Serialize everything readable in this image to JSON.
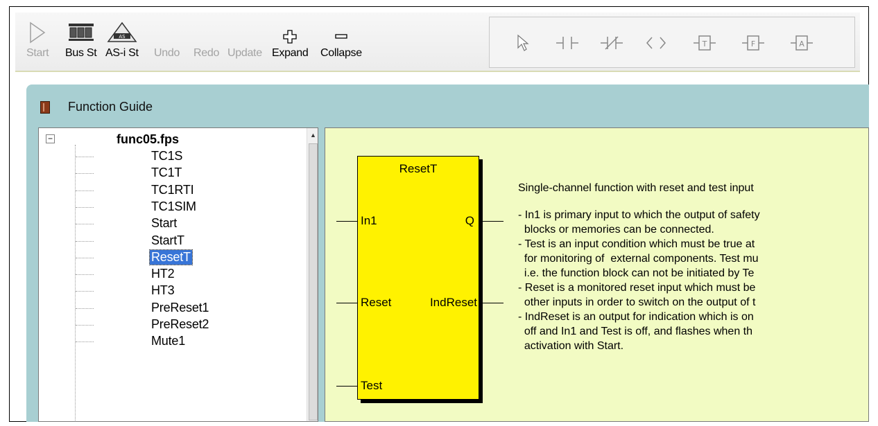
{
  "toolbar": {
    "buttons": [
      {
        "label": "Start",
        "icon": "play-triangle-icon",
        "enabled": false
      },
      {
        "label": "Bus St",
        "icon": "bus-status-icon",
        "enabled": true
      },
      {
        "label": "AS-i St",
        "icon": "asi-status-icon",
        "enabled": true
      },
      {
        "label": "Undo",
        "icon": "",
        "enabled": false
      },
      {
        "label": "Redo",
        "icon": "",
        "enabled": false
      },
      {
        "label": "Update",
        "icon": "",
        "enabled": false
      },
      {
        "label": "Expand",
        "icon": "plus-icon",
        "enabled": true
      },
      {
        "label": "Collapse",
        "icon": "minus-icon",
        "enabled": true
      }
    ],
    "ladder_tools": [
      "pointer-icon",
      "contact-no-icon",
      "contact-nc-icon",
      "coil-brackets-icon",
      "block-t-icon",
      "block-f-icon",
      "block-a-icon"
    ],
    "ladder_tool_letters": {
      "t": "T",
      "f": "F",
      "a": "A"
    }
  },
  "window": {
    "title": "Function Guide"
  },
  "tree": {
    "root": "func05.fps",
    "expander": "−",
    "scroll_arrow": "▲",
    "items": [
      "TC1S",
      "TC1T",
      "TC1RTI",
      "TC1SIM",
      "Start",
      "StartT",
      "ResetT",
      "HT2",
      "HT3",
      "PreReset1",
      "PreReset2",
      "Mute1"
    ],
    "selected": "ResetT"
  },
  "block": {
    "name": "ResetT",
    "in1": "In1",
    "q": "Q",
    "reset": "Reset",
    "indreset": "IndReset",
    "test": "Test"
  },
  "description": {
    "intro": "Single-channel function with reset and test input",
    "lines": [
      "- In1 is primary input to which the output of safety",
      "  blocks or memories can be connected.",
      "- Test is an input condition which must be true at",
      "  for monitoring of  external components. Test mu",
      "  i.e. the function block can not be initiated by Te",
      "- Reset is a monitored reset input which must be",
      "  other inputs in order to switch on the output of t",
      "- IndReset is an output for indication which is on",
      "  off and In1 and Test is off, and flashes when th",
      "  activation with Start."
    ]
  },
  "colors": {
    "panel_bg": "#f2fbc3",
    "block_fill": "#fff200",
    "window_bg": "#a8cfd2",
    "selection": "#3875d7"
  }
}
